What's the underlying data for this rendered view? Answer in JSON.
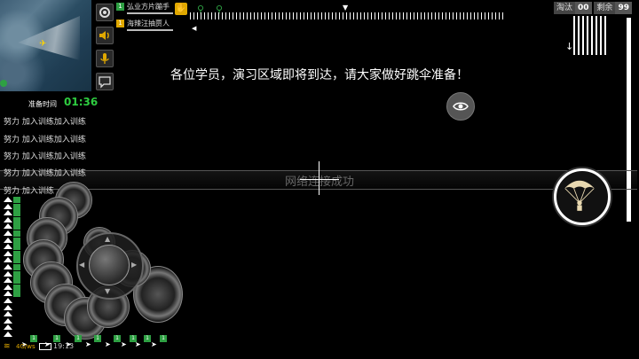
{
  "team": [
    {
      "num": "1",
      "name": "弘业方片蹦手",
      "color": "green"
    },
    {
      "num": "1",
      "name": "海辣汪抽贾人",
      "color": "orange"
    }
  ],
  "top_right": {
    "label": "淘汰",
    "eliminated": "00",
    "remaining_label": "剩余",
    "remaining": "99"
  },
  "banner": "各位学员，演习区域即将到达，请大家做好跳伞准备！",
  "network_message": "网络连接成功",
  "prep": {
    "label": "准备时间",
    "time": "01:36"
  },
  "chat": [
    "努力  加入训练加入训练",
    "努力  加入训练加入训练",
    "努力  加入训练加入训练",
    "努力  加入训练加入训练",
    "努力  加入训练"
  ],
  "status": {
    "network": "4G/ws",
    "clock": "19:13"
  },
  "bottom_flags": [
    "1",
    "1",
    "1",
    "1",
    "1",
    "1",
    "1",
    "1"
  ],
  "icons": {
    "settings": "gear-icon",
    "sound": "speaker-icon",
    "mic": "microphone-icon",
    "chat": "chat-bubble-icon",
    "view": "eye-icon",
    "parachute": "parachute-icon"
  },
  "colors": {
    "accent_green": "#2ecc40",
    "accent_orange": "#e0a800"
  }
}
